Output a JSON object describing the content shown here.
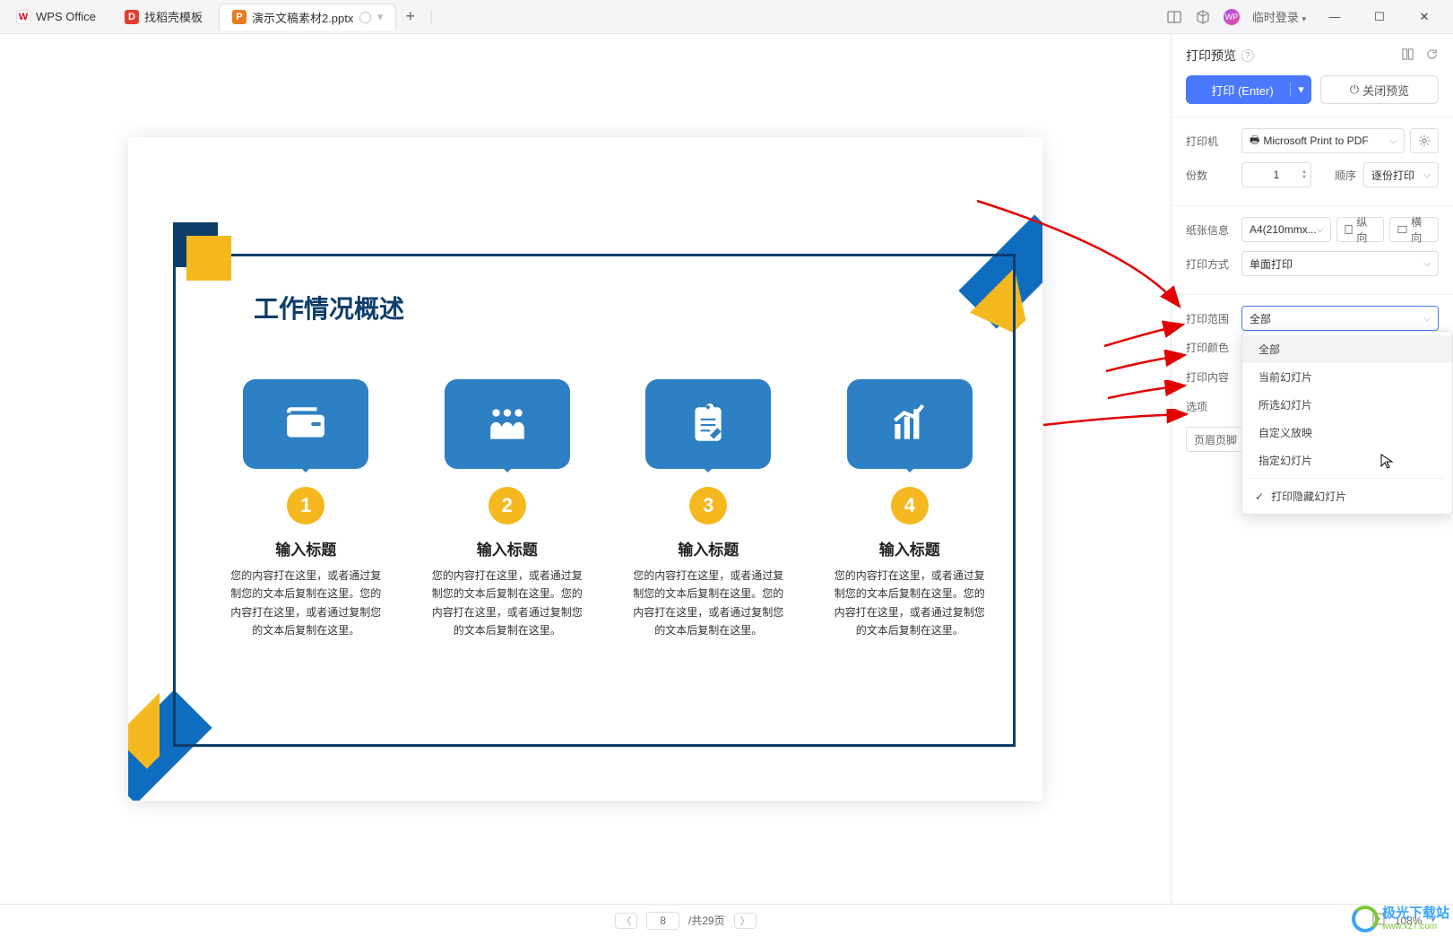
{
  "titlebar": {
    "app": "WPS Office",
    "tab_templates": "找稻壳模板",
    "tab_file": "演示文稿素材2.pptx",
    "login": "临时登录"
  },
  "slide": {
    "title": "工作情况概述",
    "cards": [
      {
        "num": "1",
        "title": "输入标题",
        "text": "您的内容打在这里，或者通过复制您的文本后复制在这里。您的内容打在这里，或者通过复制您的文本后复制在这里。"
      },
      {
        "num": "2",
        "title": "输入标题",
        "text": "您的内容打在这里，或者通过复制您的文本后复制在这里。您的内容打在这里，或者通过复制您的文本后复制在这里。"
      },
      {
        "num": "3",
        "title": "输入标题",
        "text": "您的内容打在这里，或者通过复制您的文本后复制在这里。您的内容打在这里，或者通过复制您的文本后复制在这里。"
      },
      {
        "num": "4",
        "title": "输入标题",
        "text": "您的内容打在这里，或者通过复制您的文本后复制在这里。您的内容打在这里，或者通过复制您的文本后复制在这里。"
      }
    ]
  },
  "panel": {
    "header": "打印预览",
    "print_btn": "打印 (Enter)",
    "close_btn": "关闭预览",
    "printer_label": "打印机",
    "printer_value": "Microsoft Print to PDF",
    "copies_label": "份数",
    "copies_value": "1",
    "order_label": "顺序",
    "order_value": "逐份打印",
    "paper_label": "纸张信息",
    "paper_value": "A4(210mmx...",
    "orient_portrait": "纵向",
    "orient_landscape": "横向",
    "duplex_label": "打印方式",
    "duplex_value": "单面打印",
    "range_label": "打印范围",
    "range_value": "全部",
    "color_label": "打印颜色",
    "content_label": "打印内容",
    "options_label": "选项",
    "header_footer": "页眉页脚",
    "dropdown": {
      "all": "全部",
      "current": "当前幻灯片",
      "selected": "所选幻灯片",
      "custom": "自定义放映",
      "specified": "指定幻灯片",
      "print_hidden": "打印隐藏幻灯片"
    }
  },
  "statusbar": {
    "page": "8",
    "total": "/共29页",
    "zoom": "108%"
  },
  "watermark": {
    "cn": "极光下载站",
    "url": "www.xz7.com"
  }
}
